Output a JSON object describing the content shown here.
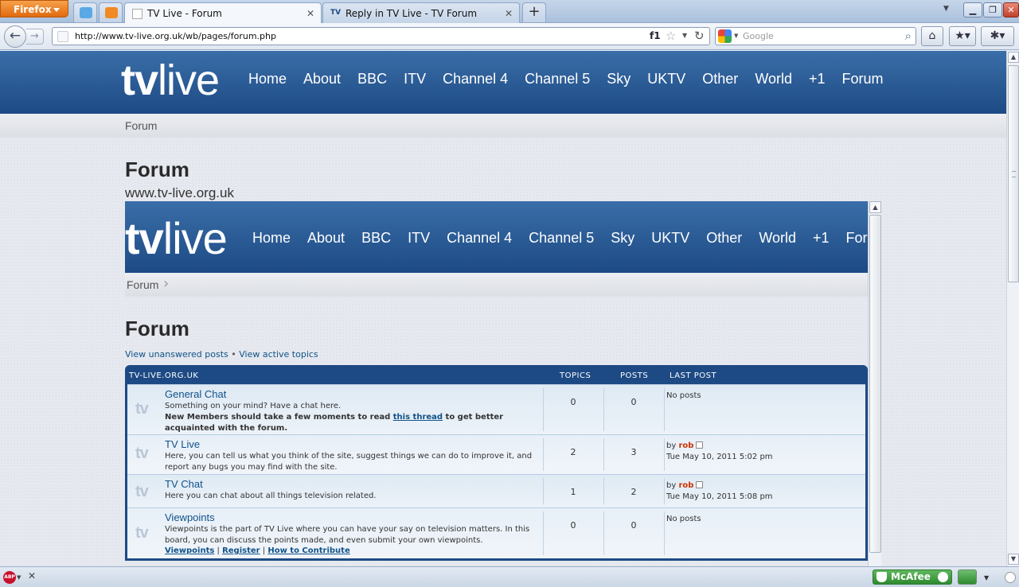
{
  "browser": {
    "menu_button": "Firefox",
    "tabs": [
      {
        "title": "TV Live - Forum",
        "active": true
      },
      {
        "title": "Reply in TV Live - TV Forum",
        "active": false
      }
    ],
    "address": "http://www.tv-live.org.uk/wb/pages/forum.php",
    "address_badge": "f1",
    "search_placeholder": "Google",
    "colors": {
      "menu_button": "#e06a10",
      "chrome": "#c6d6ea"
    }
  },
  "site": {
    "logo": {
      "bold": "tv",
      "light": "live"
    },
    "nav": [
      "Home",
      "About",
      "BBC",
      "ITV",
      "Channel 4",
      "Channel 5",
      "Sky",
      "UKTV",
      "Other",
      "World",
      "+1",
      "Forum"
    ],
    "breadcrumb": "Forum",
    "page_title": "Forum",
    "site_url": "www.tv-live.org.uk",
    "colors": {
      "header": "#1d4a84",
      "link": "#105289"
    }
  },
  "forum": {
    "breadcrumb": "Forum",
    "page_title": "Forum",
    "links": {
      "unanswered": "View unanswered posts",
      "separator": "•",
      "active": "View active topics"
    },
    "table": {
      "headers": {
        "forum": "TV-LIVE.ORG.UK",
        "topics": "TOPICS",
        "posts": "POSTS",
        "last_post": "LAST POST"
      },
      "rows": [
        {
          "icon": "tv",
          "title": "General Chat",
          "description": "Something on your mind? Have a chat here.",
          "note_before": "New Members should take a few moments to read ",
          "note_link": "this thread",
          "note_after": " to get better acquainted with the forum.",
          "topics": "0",
          "posts": "0",
          "last_post": "No posts"
        },
        {
          "icon": "tv",
          "title": "TV Live",
          "description": "Here, you can tell us what you think of the site, suggest things we can do to improve it, and report any bugs you may find with the site.",
          "topics": "2",
          "posts": "3",
          "last_by": "by",
          "last_author": "rob",
          "last_date": "Tue May 10, 2011 5:02 pm"
        },
        {
          "icon": "tv",
          "title": "TV Chat",
          "description": "Here you can chat about all things television related.",
          "topics": "1",
          "posts": "2",
          "last_by": "by",
          "last_author": "rob",
          "last_date": "Tue May 10, 2011 5:08 pm"
        },
        {
          "icon": "tv",
          "title": "Viewpoints",
          "description": "Viewpoints is the part of TV Live where you can have your say on television matters. In this board, you can discuss the points made, and even submit your own viewpoints.",
          "sublinks": [
            "Viewpoints",
            "Register",
            "How to Contribute"
          ],
          "sublink_separator": "|",
          "topics": "0",
          "posts": "0",
          "last_post": "No posts"
        }
      ]
    }
  },
  "statusbar": {
    "adblock_label": "ABP",
    "security_label": "McAfee",
    "colors": {
      "security": "#2f8a2f"
    }
  }
}
